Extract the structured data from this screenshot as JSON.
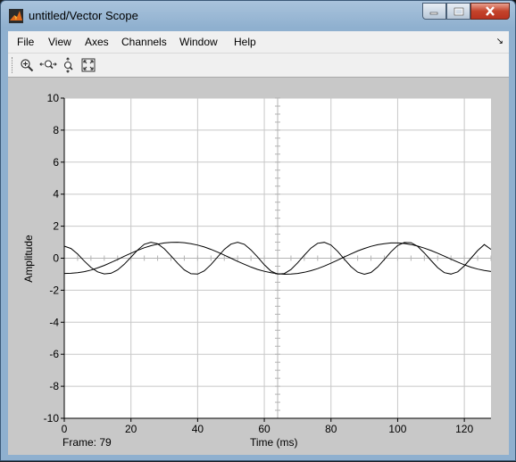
{
  "window": {
    "title": "untitled/Vector Scope"
  },
  "menu": [
    "File",
    "View",
    "Axes",
    "Channels",
    "Window",
    "Help"
  ],
  "toolbar": [
    {
      "name": "zoom-in-icon"
    },
    {
      "name": "zoom-x-icon"
    },
    {
      "name": "zoom-y-icon"
    },
    {
      "name": "autoscale-icon"
    }
  ],
  "status": {
    "frame": "Frame: 79"
  },
  "chart_data": {
    "type": "line",
    "title": "",
    "xlabel": "Time (ms)",
    "ylabel": "Amplitude",
    "xlim": [
      0,
      128
    ],
    "ylim": [
      -10,
      10
    ],
    "xticks": [
      0,
      20,
      40,
      60,
      80,
      100,
      120
    ],
    "yticks": [
      10,
      8,
      6,
      4,
      2,
      0,
      -2,
      -4,
      -6,
      -8,
      -10
    ],
    "grid": true,
    "series": [
      {
        "x": [
          0,
          2,
          4,
          6,
          8,
          10,
          12,
          14,
          16,
          18,
          20,
          22,
          24,
          26,
          28,
          30,
          32,
          34,
          36,
          38,
          40,
          42,
          44,
          46,
          48,
          50,
          52,
          54,
          56,
          58,
          60,
          62,
          64,
          66,
          68,
          70,
          72,
          74,
          76,
          78,
          80,
          82,
          84,
          86,
          88,
          90,
          92,
          94,
          96,
          98,
          100,
          102,
          104,
          106,
          108,
          110,
          112,
          114,
          116,
          118,
          120,
          122,
          124,
          126,
          128
        ],
        "values": [
          0.75,
          0.61,
          0.26,
          -0.18,
          -0.58,
          -0.85,
          -0.98,
          -0.94,
          -0.73,
          -0.38,
          0.06,
          0.51,
          0.87,
          1.0,
          0.9,
          0.59,
          0.15,
          -0.32,
          -0.73,
          -0.97,
          -0.99,
          -0.79,
          -0.4,
          0.08,
          0.55,
          0.88,
          1.0,
          0.87,
          0.52,
          0.07,
          -0.41,
          -0.8,
          -0.99,
          -0.96,
          -0.71,
          -0.29,
          0.19,
          0.63,
          0.93,
          0.99,
          0.82,
          0.43,
          -0.06,
          -0.53,
          -0.87,
          -1.0,
          -0.89,
          -0.55,
          -0.08,
          0.4,
          0.79,
          0.98,
          0.97,
          0.74,
          0.33,
          -0.14,
          -0.59,
          -0.9,
          -0.99,
          -0.85,
          -0.48,
          0.0,
          0.48,
          0.85,
          0.55
        ]
      },
      {
        "x": [
          0,
          2,
          4,
          6,
          8,
          10,
          12,
          14,
          16,
          18,
          20,
          22,
          24,
          26,
          28,
          30,
          32,
          34,
          36,
          38,
          40,
          42,
          44,
          46,
          48,
          50,
          52,
          54,
          56,
          58,
          60,
          62,
          64,
          66,
          68,
          70,
          72,
          74,
          76,
          78,
          80,
          82,
          84,
          86,
          88,
          90,
          92,
          94,
          96,
          98,
          100,
          102,
          104,
          106,
          108,
          110,
          112,
          114,
          116,
          118,
          120,
          122,
          124,
          126,
          128
        ],
        "values": [
          -0.95,
          -0.94,
          -0.91,
          -0.84,
          -0.74,
          -0.61,
          -0.45,
          -0.27,
          -0.08,
          0.12,
          0.31,
          0.49,
          0.65,
          0.78,
          0.88,
          0.95,
          0.99,
          1.0,
          0.97,
          0.91,
          0.82,
          0.7,
          0.55,
          0.38,
          0.19,
          0.0,
          -0.2,
          -0.38,
          -0.55,
          -0.7,
          -0.82,
          -0.91,
          -0.97,
          -1.0,
          -0.99,
          -0.95,
          -0.88,
          -0.78,
          -0.65,
          -0.49,
          -0.31,
          -0.12,
          0.08,
          0.27,
          0.45,
          0.61,
          0.74,
          0.84,
          0.91,
          0.95,
          0.95,
          0.92,
          0.85,
          0.76,
          0.63,
          0.48,
          0.31,
          0.13,
          -0.06,
          -0.24,
          -0.41,
          -0.56,
          -0.68,
          -0.77,
          -0.83
        ]
      }
    ]
  }
}
